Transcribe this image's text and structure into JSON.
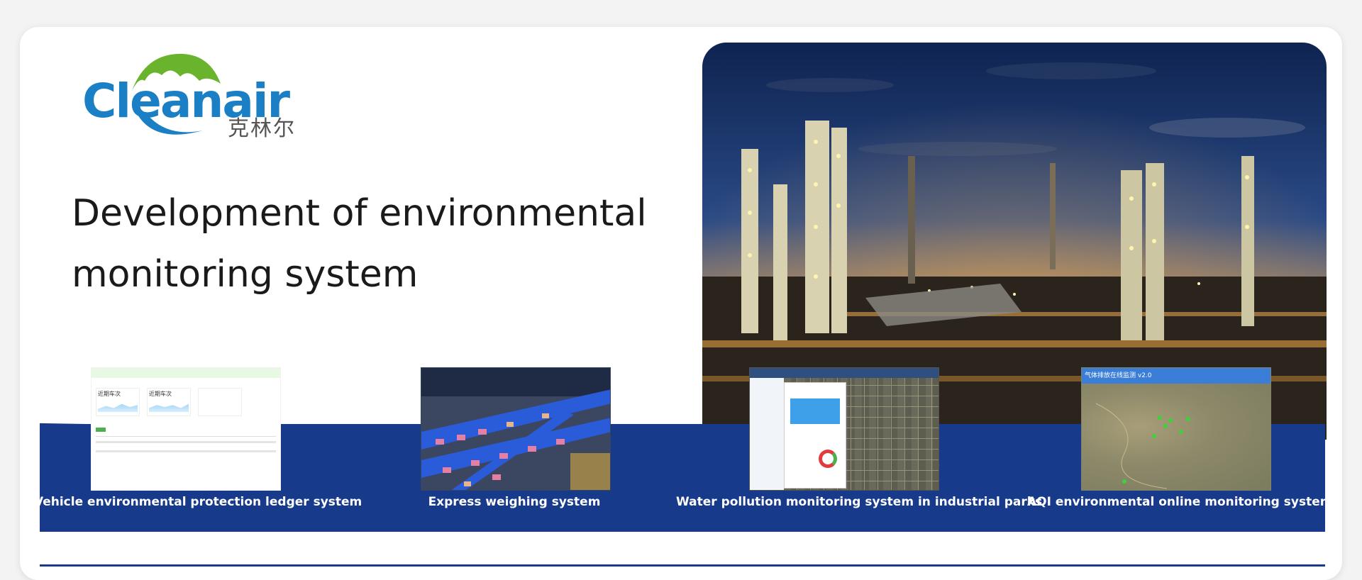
{
  "logo": {
    "brand": "Cleanair",
    "brand_cn": "克林尔"
  },
  "headline": "Development of environmental monitoring system",
  "systems": [
    {
      "caption": "Vehicle environmental protection ledger system",
      "screen": {
        "stat1": "近期车次",
        "stat2": "近期车次"
      }
    },
    {
      "caption": "Express weighing system"
    },
    {
      "caption": "Water pollution monitoring system in industrial parks"
    },
    {
      "caption": "AQI environmental online monitoring system",
      "screen": {
        "title": "气体排放在线监测 v2.0"
      }
    }
  ],
  "colors": {
    "band": "#183a8a",
    "logo_blue": "#1a7fc4",
    "logo_green": "#6ab42d"
  }
}
